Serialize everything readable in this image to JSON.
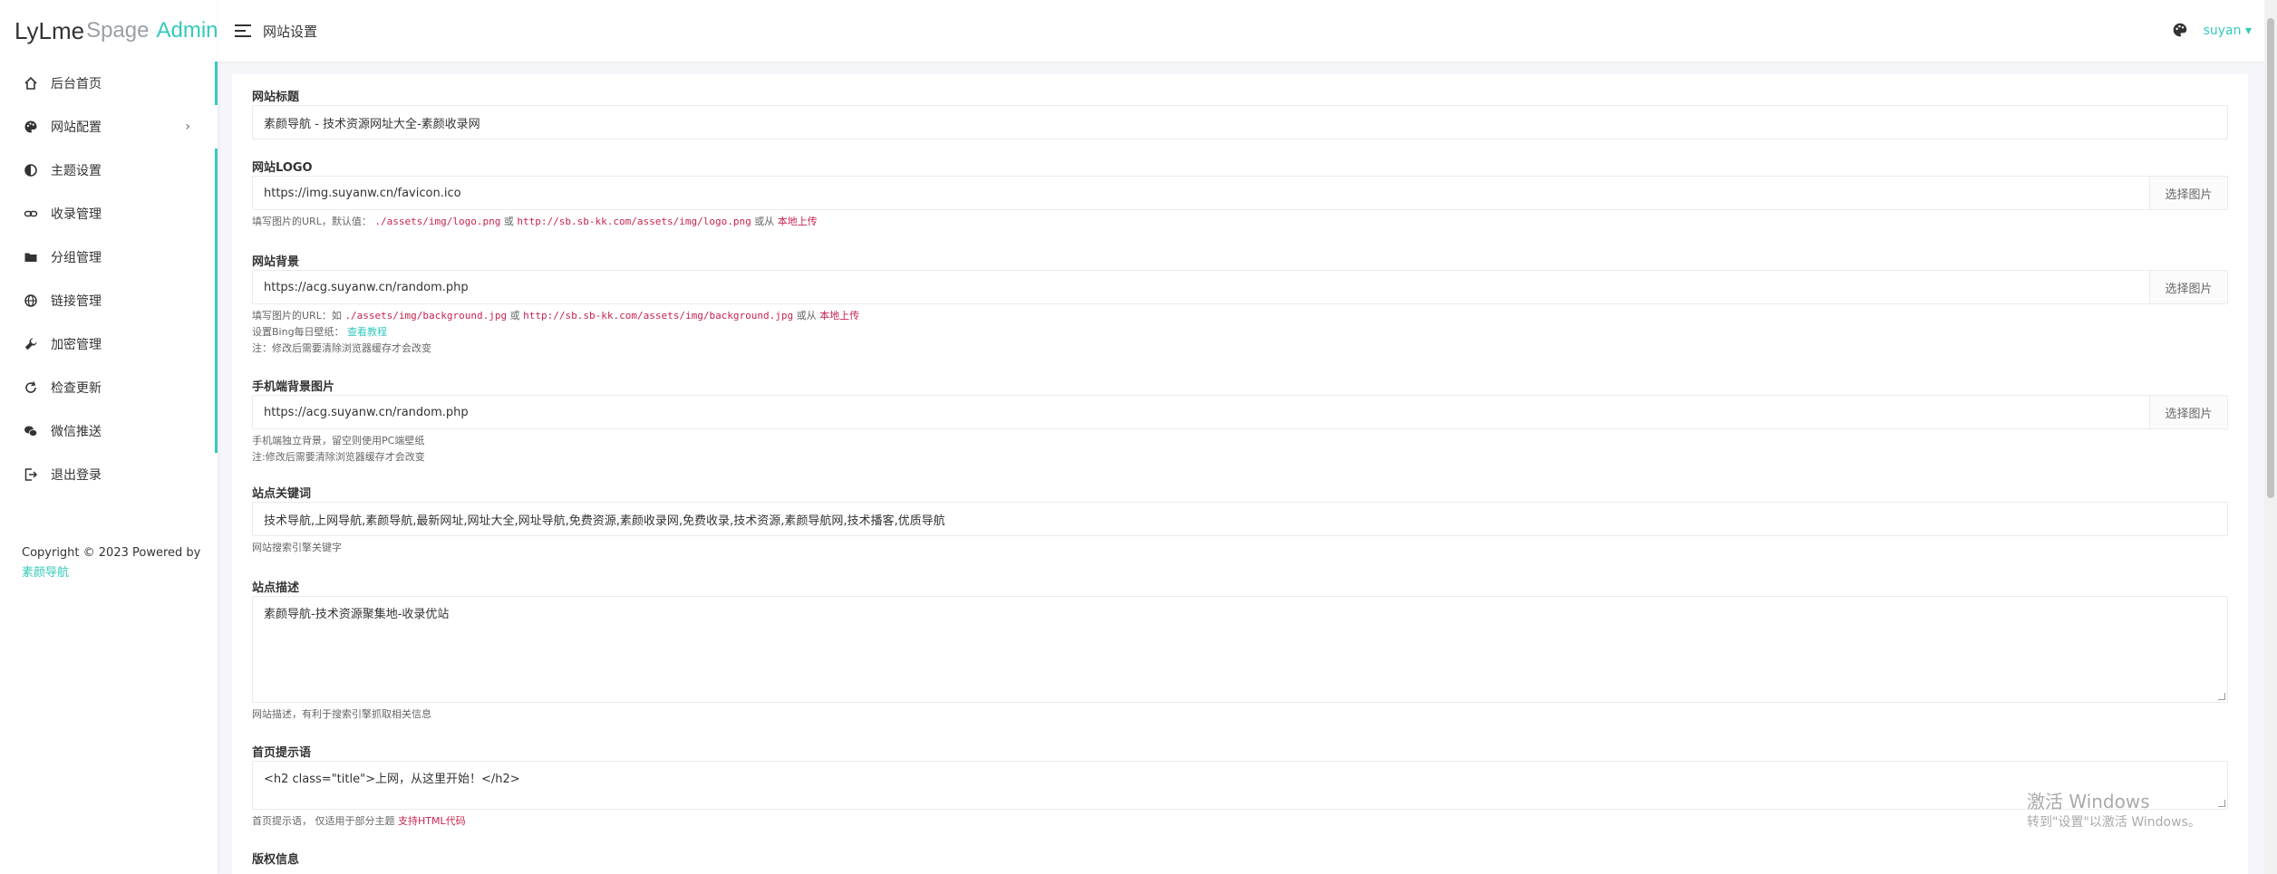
{
  "logo": {
    "part1": "LyLme",
    "part2": "Spage",
    "part3": "Admin"
  },
  "sidebar": {
    "items": [
      {
        "label": "后台首页",
        "icon": "home-icon"
      },
      {
        "label": "网站配置",
        "icon": "palette-icon",
        "chevron": "›"
      },
      {
        "label": "主题设置",
        "icon": "contrast-icon"
      },
      {
        "label": "收录管理",
        "icon": "link-icon"
      },
      {
        "label": "分组管理",
        "icon": "folder-icon"
      },
      {
        "label": "链接管理",
        "icon": "globe-icon"
      },
      {
        "label": "加密管理",
        "icon": "wrench-icon"
      },
      {
        "label": "检查更新",
        "icon": "refresh-icon"
      },
      {
        "label": "微信推送",
        "icon": "wechat-icon"
      },
      {
        "label": "退出登录",
        "icon": "logout-icon"
      }
    ],
    "copyright": "Copyright © 2023 Powered by",
    "copyright_link": "素颜导航"
  },
  "header": {
    "title": "网站设置",
    "user": "suyan ▾"
  },
  "form": {
    "site_title": {
      "label": "网站标题",
      "value": "素颜导航 - 技术资源网址大全-素颜收录网"
    },
    "logo": {
      "label": "网站LOGO",
      "value": "https://img.suyanw.cn/favicon.ico",
      "button": "选择图片",
      "help_prefix": "填写图片的URL，默认值：",
      "code1": "./assets/img/logo.png",
      "or1": "或",
      "code2": "http://sb.sb-kk.com/assets/img/logo.png",
      "or2": "或从",
      "upload": "本地上传"
    },
    "background": {
      "label": "网站背景",
      "value": "https://acg.suyanw.cn/random.php",
      "button": "选择图片",
      "help_prefix": "填写图片的URL：如",
      "code1": "./assets/img/background.jpg",
      "or1": "或",
      "code2": "http://sb.sb-kk.com/assets/img/background.jpg",
      "or2": "或从",
      "upload": "本地上传",
      "bing_prefix": "设置Bing每日壁纸：",
      "bing_link": "查看教程",
      "note": "注：修改后需要清除浏览器缓存才会改变"
    },
    "mobile_bg": {
      "label": "手机端背景图片",
      "value": "https://acg.suyanw.cn/random.php",
      "button": "选择图片",
      "help1": "手机端独立背景，留空则使用PC端壁纸",
      "help2": "注:修改后需要清除浏览器缓存才会改变"
    },
    "keywords": {
      "label": "站点关键词",
      "value": "技术导航,上网导航,素颜导航,最新网址,网址大全,网址导航,免费资源,素颜收录网,免费收录,技术资源,素颜导航网,技术播客,优质导航",
      "help": "网站搜索引擎关键字"
    },
    "description": {
      "label": "站点描述",
      "value": "素颜导航-技术资源聚集地-收录优站",
      "help": "网站描述，有利于搜索引擎抓取相关信息"
    },
    "home_tip": {
      "label": "首页提示语",
      "value": "<h2 class=\"title\">上网，从这里开始！</h2>",
      "help_prefix": "首页提示语， 仅适用于部分主题",
      "help_red": "支持HTML代码"
    },
    "copyright": {
      "label": "版权信息"
    }
  },
  "watermark": {
    "line1": "激活 Windows",
    "line2": "转到\"设置\"以激活 Windows。"
  }
}
